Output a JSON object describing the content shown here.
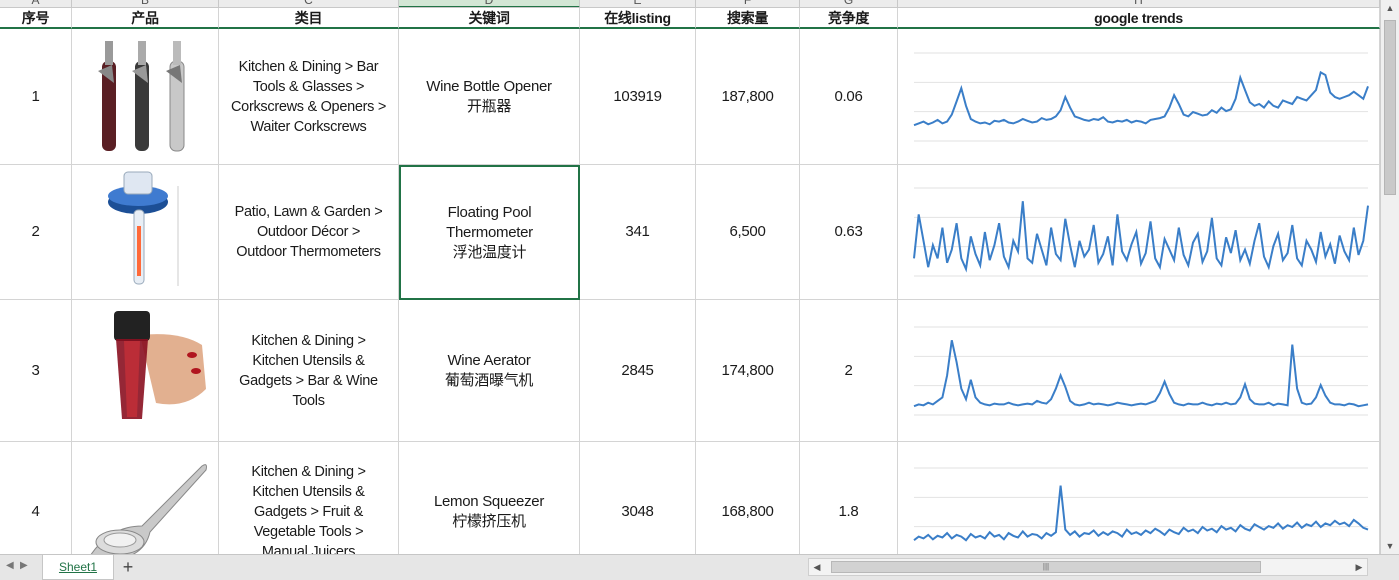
{
  "column_letters": [
    "A",
    "B",
    "C",
    "D",
    "E",
    "F",
    "G",
    "H"
  ],
  "headers": [
    "序号",
    "产品",
    "类目",
    "关键词",
    "在线listing",
    "搜索量",
    "竞争度",
    "google trends"
  ],
  "rows": [
    {
      "index": "1",
      "product_image": "corkscrew-image",
      "category": [
        "Kitchen & Dining > Bar",
        "Tools & Glasses >",
        "Corkscrews & Openers >",
        "Waiter Corkscrews"
      ],
      "keyword_en": [
        "Wine Bottle Opener"
      ],
      "keyword_cn": "开瓶器",
      "listings": "103919",
      "search_volume": "187,800",
      "competition": "0.06",
      "trend": [
        18,
        20,
        22,
        19,
        21,
        24,
        20,
        22,
        30,
        45,
        60,
        40,
        25,
        22,
        20,
        21,
        19,
        23,
        22,
        24,
        21,
        20,
        22,
        25,
        23,
        21,
        22,
        26,
        24,
        25,
        28,
        35,
        50,
        38,
        28,
        26,
        24,
        23,
        25,
        24,
        27,
        22,
        21,
        23,
        22,
        24,
        21,
        23,
        22,
        20,
        24,
        25,
        26,
        28,
        38,
        52,
        42,
        30,
        28,
        33,
        31,
        29,
        30,
        35,
        32,
        38,
        34,
        36,
        48,
        72,
        58,
        44,
        40,
        42,
        38,
        45,
        40,
        38,
        46,
        44,
        42,
        50,
        48,
        46,
        52,
        58,
        78,
        75,
        55,
        50,
        48,
        50,
        52,
        56,
        52,
        48,
        62
      ]
    },
    {
      "index": "2",
      "product_image": "pool-thermometer-image",
      "category": [
        "Patio, Lawn & Garden >",
        "Outdoor Décor >",
        "Outdoor Thermometers"
      ],
      "keyword_en": [
        "Floating Pool",
        "Thermometer"
      ],
      "keyword_cn": "浮池温度计",
      "listings": "341",
      "search_volume": "6,500",
      "competition": "0.63",
      "trend": [
        20,
        70,
        40,
        10,
        35,
        20,
        55,
        15,
        30,
        60,
        20,
        8,
        45,
        25,
        12,
        50,
        18,
        35,
        60,
        22,
        10,
        40,
        28,
        85,
        20,
        15,
        48,
        30,
        12,
        55,
        25,
        18,
        65,
        35,
        10,
        40,
        22,
        30,
        58,
        15,
        25,
        45,
        12,
        70,
        28,
        18,
        36,
        50,
        14,
        26,
        62,
        20,
        10,
        42,
        30,
        18,
        55,
        24,
        12,
        38,
        48,
        16,
        28,
        66,
        20,
        12,
        44,
        26,
        52,
        18,
        30,
        14,
        40,
        60,
        22,
        10,
        34,
        48,
        18,
        26,
        58,
        20,
        12,
        40,
        30,
        16,
        50,
        22,
        36,
        14,
        46,
        28,
        18,
        55,
        24,
        40,
        80
      ]
    },
    {
      "index": "3",
      "product_image": "wine-aerator-image",
      "category": [
        "Kitchen & Dining >",
        "Kitchen Utensils &",
        "Gadgets > Bar & Wine",
        "Tools"
      ],
      "keyword_en": [
        "Wine Aerator"
      ],
      "keyword_cn": "葡萄酒曝气机",
      "listings": "2845",
      "search_volume": "174,800",
      "competition": "2",
      "trend": [
        10,
        12,
        11,
        14,
        12,
        16,
        20,
        45,
        85,
        60,
        30,
        18,
        40,
        20,
        14,
        12,
        11,
        13,
        12,
        12,
        14,
        12,
        11,
        12,
        13,
        12,
        16,
        14,
        13,
        18,
        30,
        45,
        32,
        16,
        12,
        11,
        12,
        14,
        12,
        13,
        12,
        11,
        12,
        14,
        13,
        12,
        11,
        12,
        13,
        12,
        14,
        16,
        25,
        38,
        24,
        14,
        12,
        11,
        13,
        12,
        12,
        14,
        12,
        11,
        13,
        12,
        14,
        12,
        13,
        20,
        35,
        18,
        13,
        12,
        12,
        14,
        11,
        13,
        12,
        11,
        80,
        30,
        14,
        12,
        13,
        20,
        34,
        22,
        14,
        12,
        12,
        11,
        13,
        12,
        10,
        11,
        12
      ]
    },
    {
      "index": "4",
      "product_image": "lemon-squeezer-image",
      "category": [
        "Kitchen & Dining >",
        "Kitchen Utensils &",
        "Gadgets > Fruit &",
        "Vegetable Tools >",
        "Manual Juicers"
      ],
      "keyword_en": [
        "Lemon Squeezer"
      ],
      "keyword_cn": "柠檬挤压机",
      "listings": "3048",
      "search_volume": "168,800",
      "competition": "1.8",
      "trend": [
        18,
        22,
        20,
        24,
        19,
        23,
        21,
        26,
        20,
        24,
        22,
        18,
        25,
        21,
        23,
        20,
        27,
        22,
        24,
        19,
        26,
        23,
        21,
        28,
        22,
        25,
        24,
        20,
        26,
        23,
        27,
        80,
        30,
        24,
        28,
        22,
        26,
        25,
        29,
        23,
        27,
        24,
        28,
        26,
        22,
        30,
        25,
        27,
        24,
        29,
        26,
        31,
        28,
        24,
        30,
        27,
        25,
        32,
        28,
        30,
        26,
        33,
        29,
        31,
        27,
        34,
        30,
        32,
        28,
        35,
        31,
        29,
        36,
        33,
        30,
        34,
        32,
        37,
        31,
        35,
        33,
        38,
        32,
        36,
        34,
        39,
        33,
        37,
        35,
        40,
        36,
        38,
        34,
        41,
        37,
        32,
        30
      ]
    }
  ],
  "sheet_tab": "Sheet1",
  "colors": {
    "accent": "#217346",
    "trend_line": "#3a7ec8"
  }
}
